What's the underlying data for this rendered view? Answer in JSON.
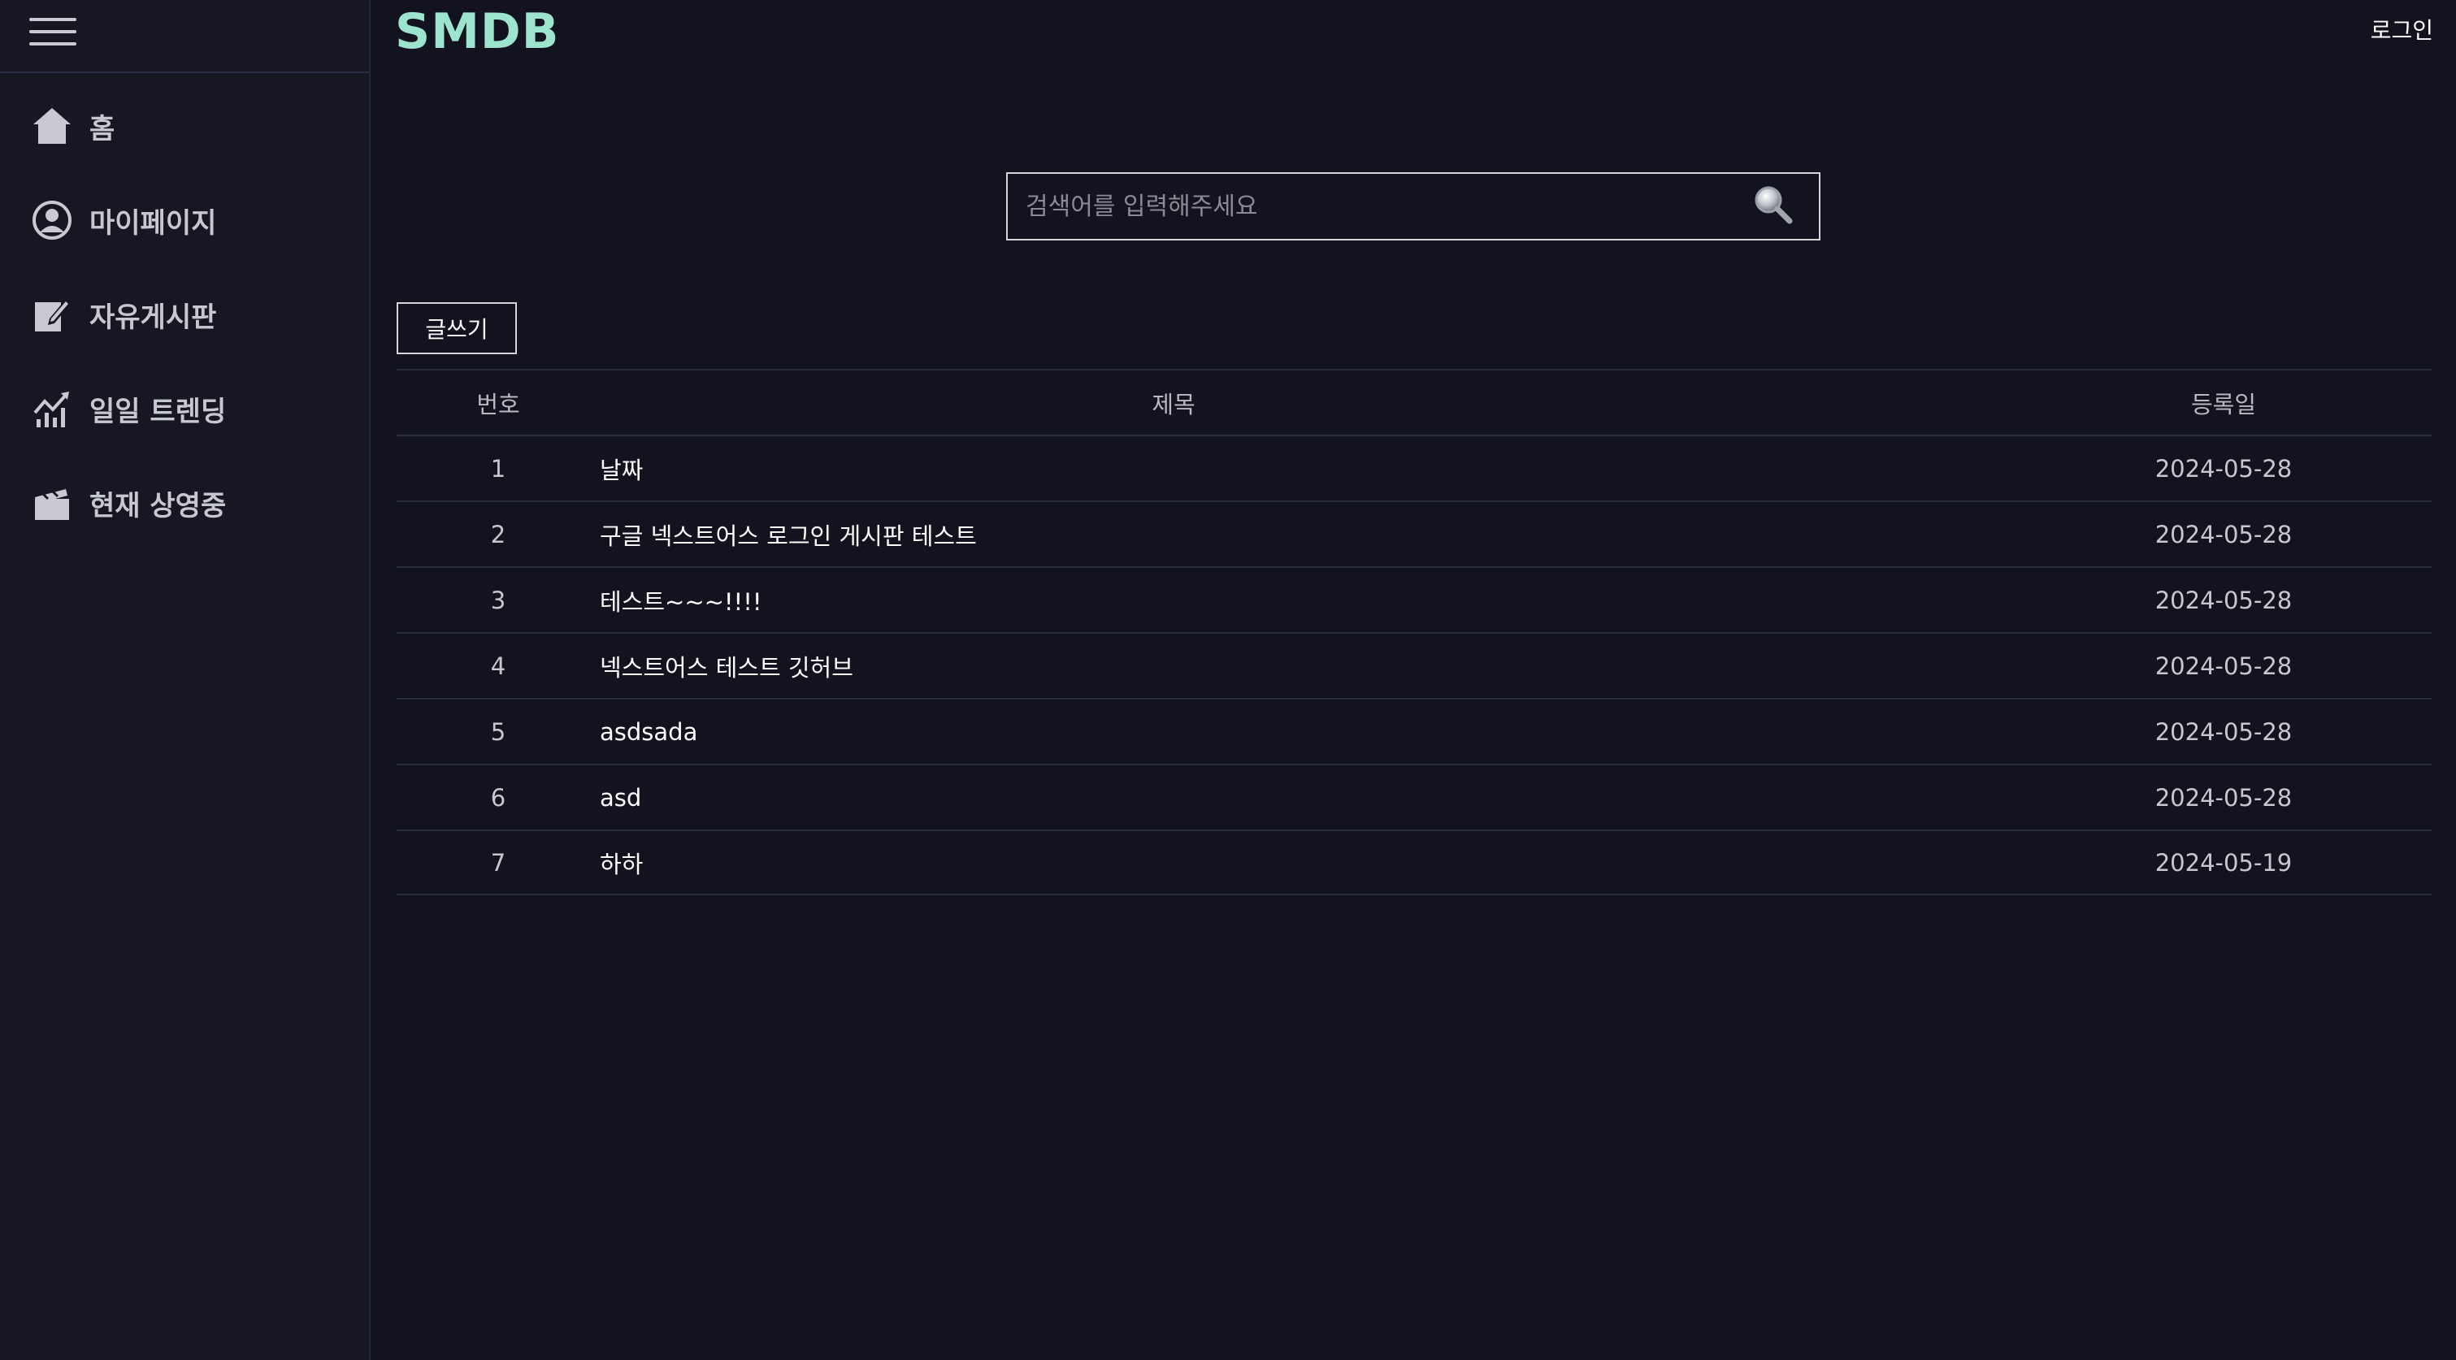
{
  "sidebar": {
    "items": [
      {
        "label": "홈",
        "icon": "home-icon"
      },
      {
        "label": "마이페이지",
        "icon": "user-circle-icon"
      },
      {
        "label": "자유게시판",
        "icon": "edit-icon"
      },
      {
        "label": "일일 트렌딩",
        "icon": "trending-chart-icon"
      },
      {
        "label": "현재 상영중",
        "icon": "clapperboard-icon"
      }
    ]
  },
  "header": {
    "logo": "SMDB",
    "login_label": "로그인"
  },
  "search": {
    "placeholder": "검색어를 입력해주세요"
  },
  "board": {
    "write_label": "글쓰기",
    "columns": {
      "no": "번호",
      "title": "제목",
      "date": "등록일"
    },
    "rows": [
      {
        "no": "1",
        "title": "날짜",
        "date": "2024-05-28"
      },
      {
        "no": "2",
        "title": "구글 넥스트어스 로그인 게시판 테스트",
        "date": "2024-05-28"
      },
      {
        "no": "3",
        "title": "테스트~~~!!!!",
        "date": "2024-05-28"
      },
      {
        "no": "4",
        "title": "넥스트어스 테스트 깃허브",
        "date": "2024-05-28"
      },
      {
        "no": "5",
        "title": "asdsada",
        "date": "2024-05-28"
      },
      {
        "no": "6",
        "title": "asd",
        "date": "2024-05-28"
      },
      {
        "no": "7",
        "title": "하하",
        "date": "2024-05-19"
      }
    ]
  },
  "colors": {
    "background": "#12131f",
    "sidebar": "#161722",
    "logo": "#9de4cf"
  }
}
